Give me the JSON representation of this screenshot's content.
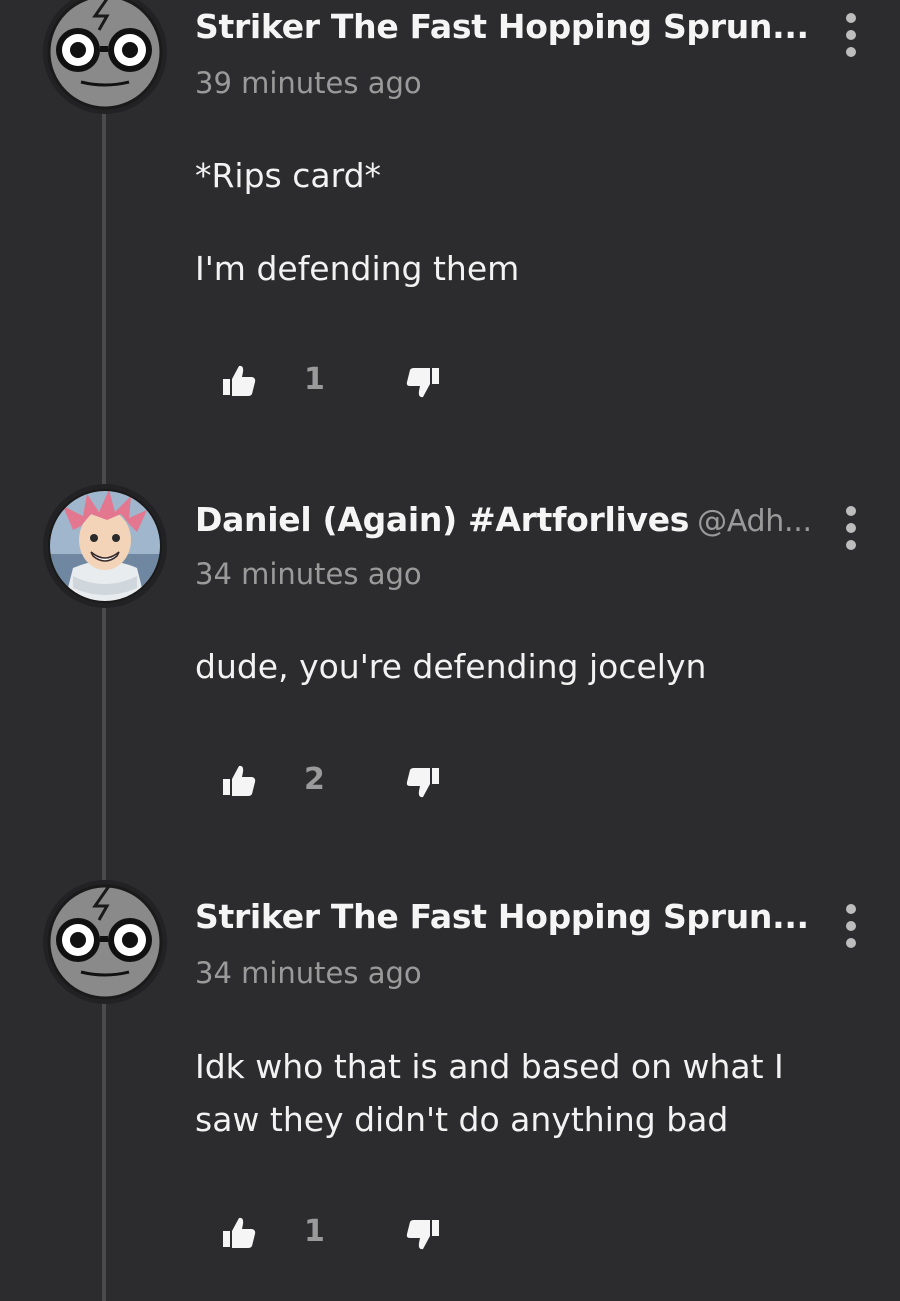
{
  "comments": [
    {
      "username": "Striker The Fast Hopping Sprun...",
      "handle": "",
      "timestamp": "39 minutes ago",
      "lines": [
        "*Rips card*",
        "I'm defending them"
      ],
      "likes": "1",
      "avatar": "sprunki-face-avatar"
    },
    {
      "username": "Daniel (Again) #Artforlives",
      "handle": "@Adh...",
      "timestamp": "34 minutes ago",
      "lines": [
        "dude, you're defending jocelyn"
      ],
      "likes": "2",
      "avatar": "anime-character-avatar"
    },
    {
      "username": "Striker The Fast Hopping Sprun...",
      "handle": "",
      "timestamp": "34 minutes ago",
      "lines": [
        "Idk who that is and based on what I",
        "saw they didn't do anything bad"
      ],
      "likes": "1",
      "avatar": "sprunki-face-avatar"
    }
  ],
  "icons": {
    "like": "thumbs-up-icon",
    "dislike": "thumbs-down-icon",
    "more": "more-options-icon"
  },
  "colors": {
    "background": "#2c2c2e",
    "thread_line": "#4b4b4d",
    "muted_text": "#9a9a9a",
    "primary_text": "#f2f2f2"
  }
}
